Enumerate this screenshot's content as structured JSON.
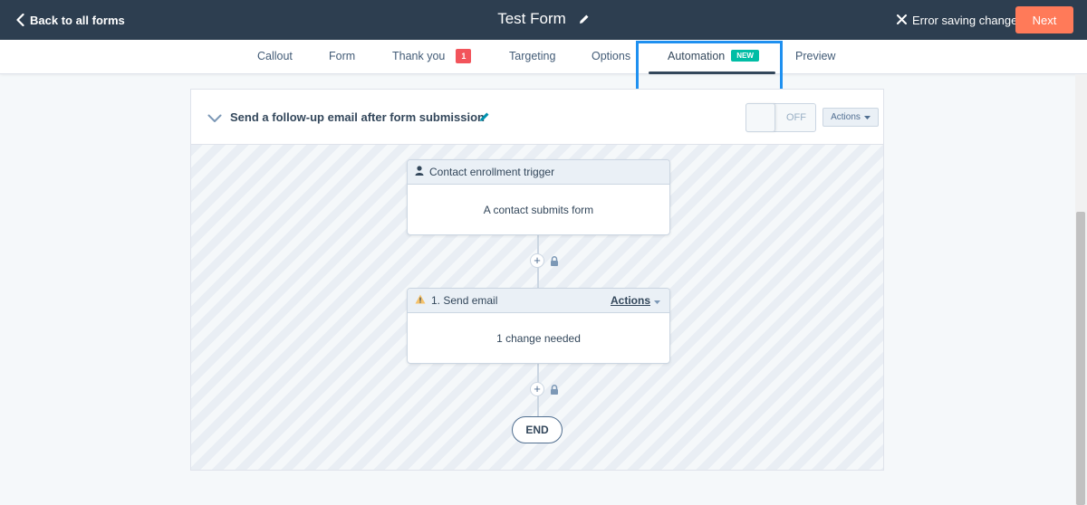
{
  "header": {
    "back_label": "Back to all forms",
    "form_title": "Test Form",
    "error_status": "Error saving changes",
    "next_label": "Next"
  },
  "tabs": [
    {
      "label": "Callout"
    },
    {
      "label": "Form"
    },
    {
      "label": "Thank you",
      "badge": "1"
    },
    {
      "label": "Targeting"
    },
    {
      "label": "Options"
    },
    {
      "label": "Automation",
      "badge": "NEW",
      "active": true
    },
    {
      "label": "Preview"
    }
  ],
  "workflow": {
    "title": "Send a follow-up email after form submission",
    "toggle_state": "OFF",
    "actions_label": "Actions",
    "trigger": {
      "title": "Contact enrollment trigger",
      "body": "A contact submits form"
    },
    "step": {
      "title": "1. Send email",
      "actions_label": "Actions",
      "body": "1 change needed"
    },
    "end_label": "END"
  },
  "colors": {
    "topbar": "#2d3e50",
    "next_button": "#ff7a59",
    "badge_red": "#f2545b",
    "badge_new": "#00bda5",
    "highlight": "#1e90f0",
    "warning": "#f5c26b"
  },
  "icons": [
    "chevron-left-icon",
    "pencil-icon",
    "close-icon",
    "chevron-down-icon",
    "person-icon",
    "warning-icon",
    "plus-icon",
    "lock-icon",
    "caret-down-icon"
  ]
}
